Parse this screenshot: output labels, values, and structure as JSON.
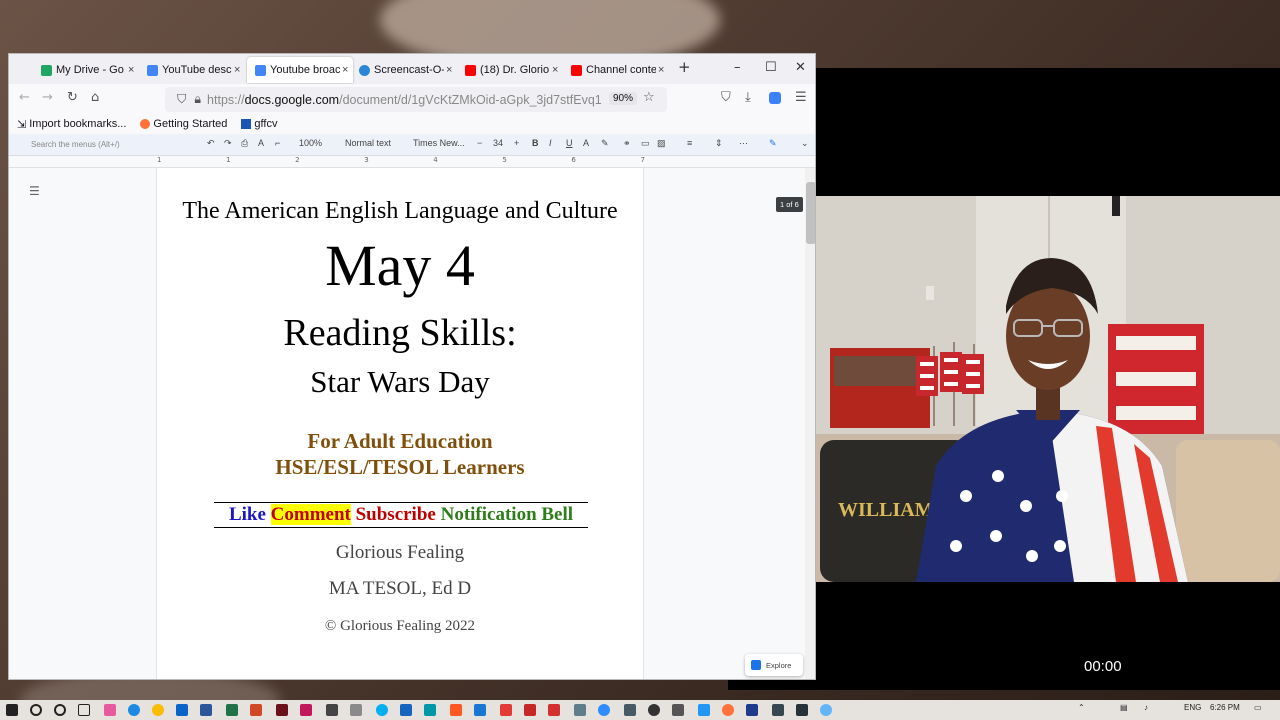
{
  "browser": {
    "tabs": [
      {
        "label": "My Drive - Go",
        "favicon_color": "#1fa463"
      },
      {
        "label": "YouTube desc",
        "favicon_color": "#4285f4"
      },
      {
        "label": "Youtube broac",
        "favicon_color": "#4285f4"
      },
      {
        "label": "Screencast-O-",
        "favicon_color": "#2a86d8"
      },
      {
        "label": "(18) Dr. Glorio",
        "favicon_color": "#ff0000"
      },
      {
        "label": "Channel conte",
        "favicon_color": "#ff0000"
      }
    ],
    "close_glyph": "×",
    "new_tab_glyph": "+",
    "url_prefix": "https://",
    "url_host": "docs.google.com",
    "url_path": "/document/d/1gVcKtZMkOid-aGpk_3jd7stfEvq1",
    "zoom": "90%",
    "bookmarks": [
      {
        "label": "Import bookmarks...",
        "icon": "import-icon"
      },
      {
        "label": "Getting Started",
        "icon": "firefox-icon"
      },
      {
        "label": "gffcv",
        "icon": "app-icon"
      }
    ]
  },
  "docs": {
    "menu_search_placeholder": "Search the menus (Alt+/)",
    "zoom": "100%",
    "style": "Normal text",
    "font": "Times New...",
    "font_size": "34",
    "page_counter": "1 of 6",
    "explore_label": "Explore",
    "ruler_marks": [
      "1",
      "1",
      "2",
      "3",
      "4",
      "5",
      "6",
      "7"
    ]
  },
  "document": {
    "course": "The American English Language and Culture",
    "date": "May 4",
    "topic": "Reading Skills:",
    "subtopic": "Star Wars Day",
    "audience_line1": "For Adult Education",
    "audience_line2": "HSE/ESL/TESOL Learners",
    "cta_like": "Like",
    "cta_comment": "Comment",
    "cta_subscribe": "Subscribe",
    "cta_bell": "Notification Bell",
    "author": "Glorious Fealing",
    "degree": "MA TESOL, Ed D",
    "copyright": "© Glorious Fealing 2022"
  },
  "overlay": {
    "timer": "00:00"
  },
  "taskbar": {
    "language": "ENG",
    "time": "6:26 PM"
  }
}
